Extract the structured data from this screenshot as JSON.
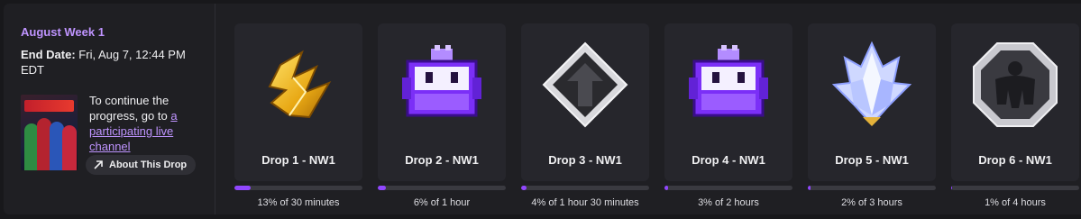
{
  "campaign": {
    "title": "August Week 1",
    "end_date_label": "End Date:",
    "end_date_value": "Fri, Aug 7, 12:44 PM EDT",
    "message_text": "To continue the progress, go to ",
    "message_link": "a participating live channel",
    "about_button": "About This Drop",
    "game_art_icon": "marvel-contest-of-champions-box-art"
  },
  "colors": {
    "accent": "#bf94ff",
    "progress_fill": "#9147ff",
    "card_bg": "#26262c"
  },
  "drops": [
    {
      "name": "Drop 1 - NW1",
      "progress_text": "13% of 30 minutes",
      "progress": 0.13,
      "icon": "gold-shards-icon"
    },
    {
      "name": "Drop 2 - NW1",
      "progress_text": "6% of 1 hour",
      "progress": 0.06,
      "icon": "purple-robot-icon"
    },
    {
      "name": "Drop 3 - NW1",
      "progress_text": "4% of 1 hour 30 minutes",
      "progress": 0.04,
      "icon": "silver-arrow-diamond-icon"
    },
    {
      "name": "Drop 4 - NW1",
      "progress_text": "3% of 2 hours",
      "progress": 0.03,
      "icon": "purple-robot-icon"
    },
    {
      "name": "Drop 5 - NW1",
      "progress_text": "2% of 3 hours",
      "progress": 0.02,
      "icon": "crystal-icon"
    },
    {
      "name": "Drop 6 - NW1",
      "progress_text": "1% of 4 hours",
      "progress": 0.01,
      "icon": "hulk-silhouette-icon"
    }
  ]
}
